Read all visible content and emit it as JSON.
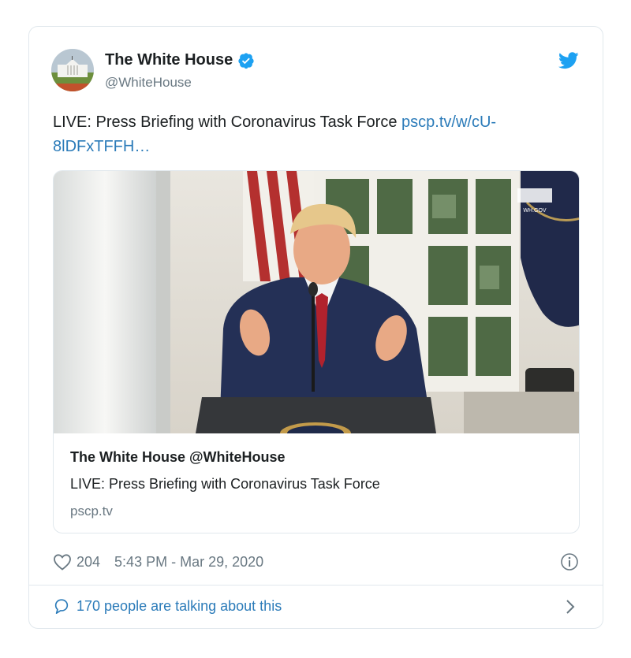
{
  "author": {
    "name": "The White House",
    "handle": "@WhiteHouse",
    "verified": true
  },
  "tweet": {
    "text": "LIVE: Press Briefing with Coronavirus Task Force ",
    "link_text": "pscp.tv/w/cU-8lDFxTFFH…"
  },
  "media_card": {
    "title": "The White House @WhiteHouse",
    "description": "LIVE: Press Briefing with Coronavirus Task Force",
    "domain": "pscp.tv",
    "watermark": "WH.GOV"
  },
  "footer": {
    "likes": "204",
    "timestamp": "5:43 PM - Mar 29, 2020",
    "talking": "170 people are talking about this"
  },
  "icons": {
    "bird": "twitter-bird-icon",
    "verified": "verified-badge-icon",
    "heart": "heart-icon",
    "info": "info-icon",
    "comment": "comment-bubble-icon",
    "chevron": "chevron-right-icon"
  },
  "colors": {
    "link": "#2b7bb9",
    "verified": "#1da1f2",
    "muted": "#697882",
    "border": "#e1e8ed"
  }
}
